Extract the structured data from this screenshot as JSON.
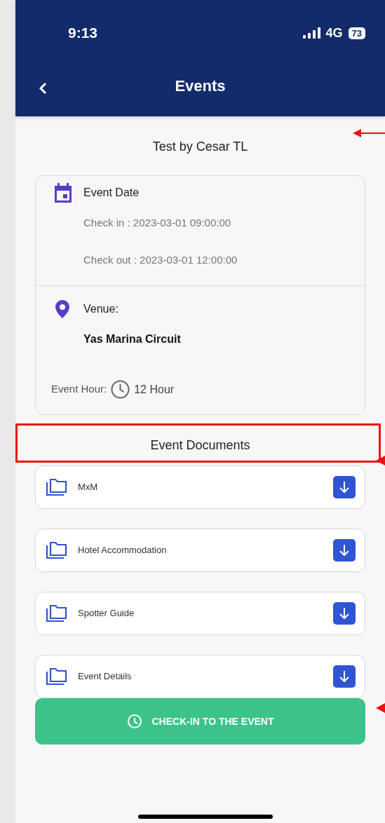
{
  "status_bar": {
    "time": "9:13",
    "network": "4G",
    "battery": "73"
  },
  "header": {
    "title": "Events"
  },
  "event_name": "Test by Cesar TL",
  "date_section": {
    "label": "Event Date",
    "check_in": "Check in : 2023-03-01 09:00:00",
    "check_out": "Check out : 2023-03-01 12:00:00"
  },
  "venue_section": {
    "label": "Venue:",
    "name": "Yas Marina Circuit",
    "hour_label": "Event Hour:",
    "hour_value": "12 Hour"
  },
  "documents": {
    "title": "Event Documents",
    "items": [
      {
        "name": "MxM"
      },
      {
        "name": "Hotel Accommodation"
      },
      {
        "name": "Spotter Guide"
      },
      {
        "name": "Event Details"
      }
    ]
  },
  "check_in_button": "CHECK-IN TO THE EVENT"
}
